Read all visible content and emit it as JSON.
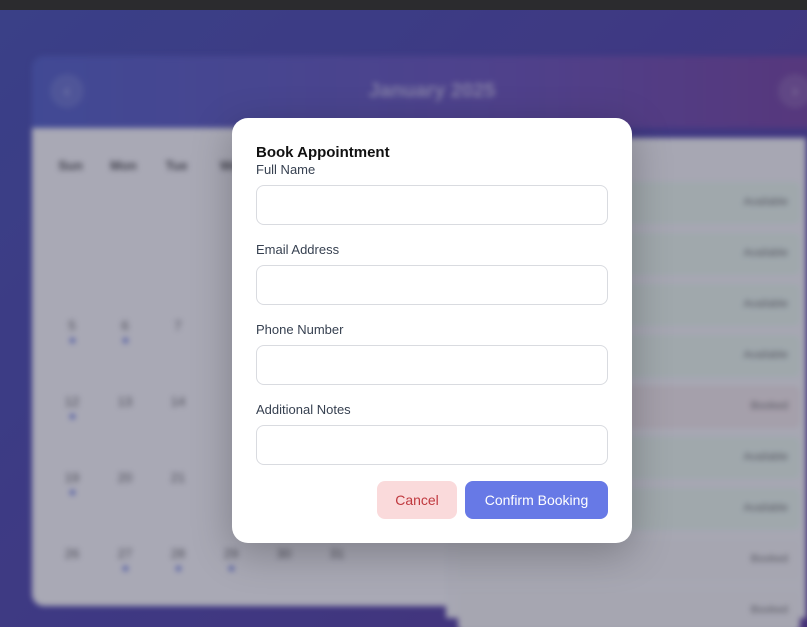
{
  "background": {
    "calendar_month": "January 2025",
    "nav_prev": "‹",
    "nav_next": "›",
    "weekdays": [
      "Sun",
      "Mon",
      "Tue",
      "We"
    ],
    "days": [
      {
        "label": "5",
        "dot": true
      },
      {
        "label": "6",
        "dot": true
      },
      {
        "label": "7",
        "dot": false
      },
      {
        "label": "12",
        "dot": true
      },
      {
        "label": "13",
        "dot": false
      },
      {
        "label": "14",
        "dot": false
      },
      {
        "label": "19",
        "dot": true
      },
      {
        "label": "20",
        "dot": false
      },
      {
        "label": "21",
        "dot": false
      },
      {
        "label": "26",
        "dot": false
      },
      {
        "label": "27",
        "dot": true
      },
      {
        "label": "28",
        "dot": true
      },
      {
        "label": "29",
        "dot": true
      },
      {
        "label": "30",
        "dot": false
      },
      {
        "label": "31",
        "dot": false
      }
    ],
    "slots": [
      {
        "status": "Available",
        "type": "available"
      },
      {
        "status": "Available",
        "type": "available"
      },
      {
        "status": "Available",
        "type": "available"
      },
      {
        "status": "Available",
        "type": "available"
      },
      {
        "status": "Booked",
        "type": "booked"
      },
      {
        "status": "Available",
        "type": "available"
      },
      {
        "status": "Available",
        "type": "available"
      },
      {
        "status": "Booked",
        "type": "plain"
      },
      {
        "status": "Booked",
        "type": "plain"
      }
    ]
  },
  "modal": {
    "title": "Book Appointment",
    "fields": {
      "full_name": {
        "label": "Full Name",
        "value": "",
        "placeholder": ""
      },
      "email": {
        "label": "Email Address",
        "value": "",
        "placeholder": ""
      },
      "phone": {
        "label": "Phone Number",
        "value": "",
        "placeholder": ""
      },
      "notes": {
        "label": "Additional Notes",
        "value": "",
        "placeholder": ""
      }
    },
    "cancel_label": "Cancel",
    "confirm_label": "Confirm Booking"
  },
  "colors": {
    "accent": "#6779e6",
    "cancel_bg": "#fadadb",
    "cancel_text": "#c0393f",
    "backdrop": "#4f4aa8"
  }
}
